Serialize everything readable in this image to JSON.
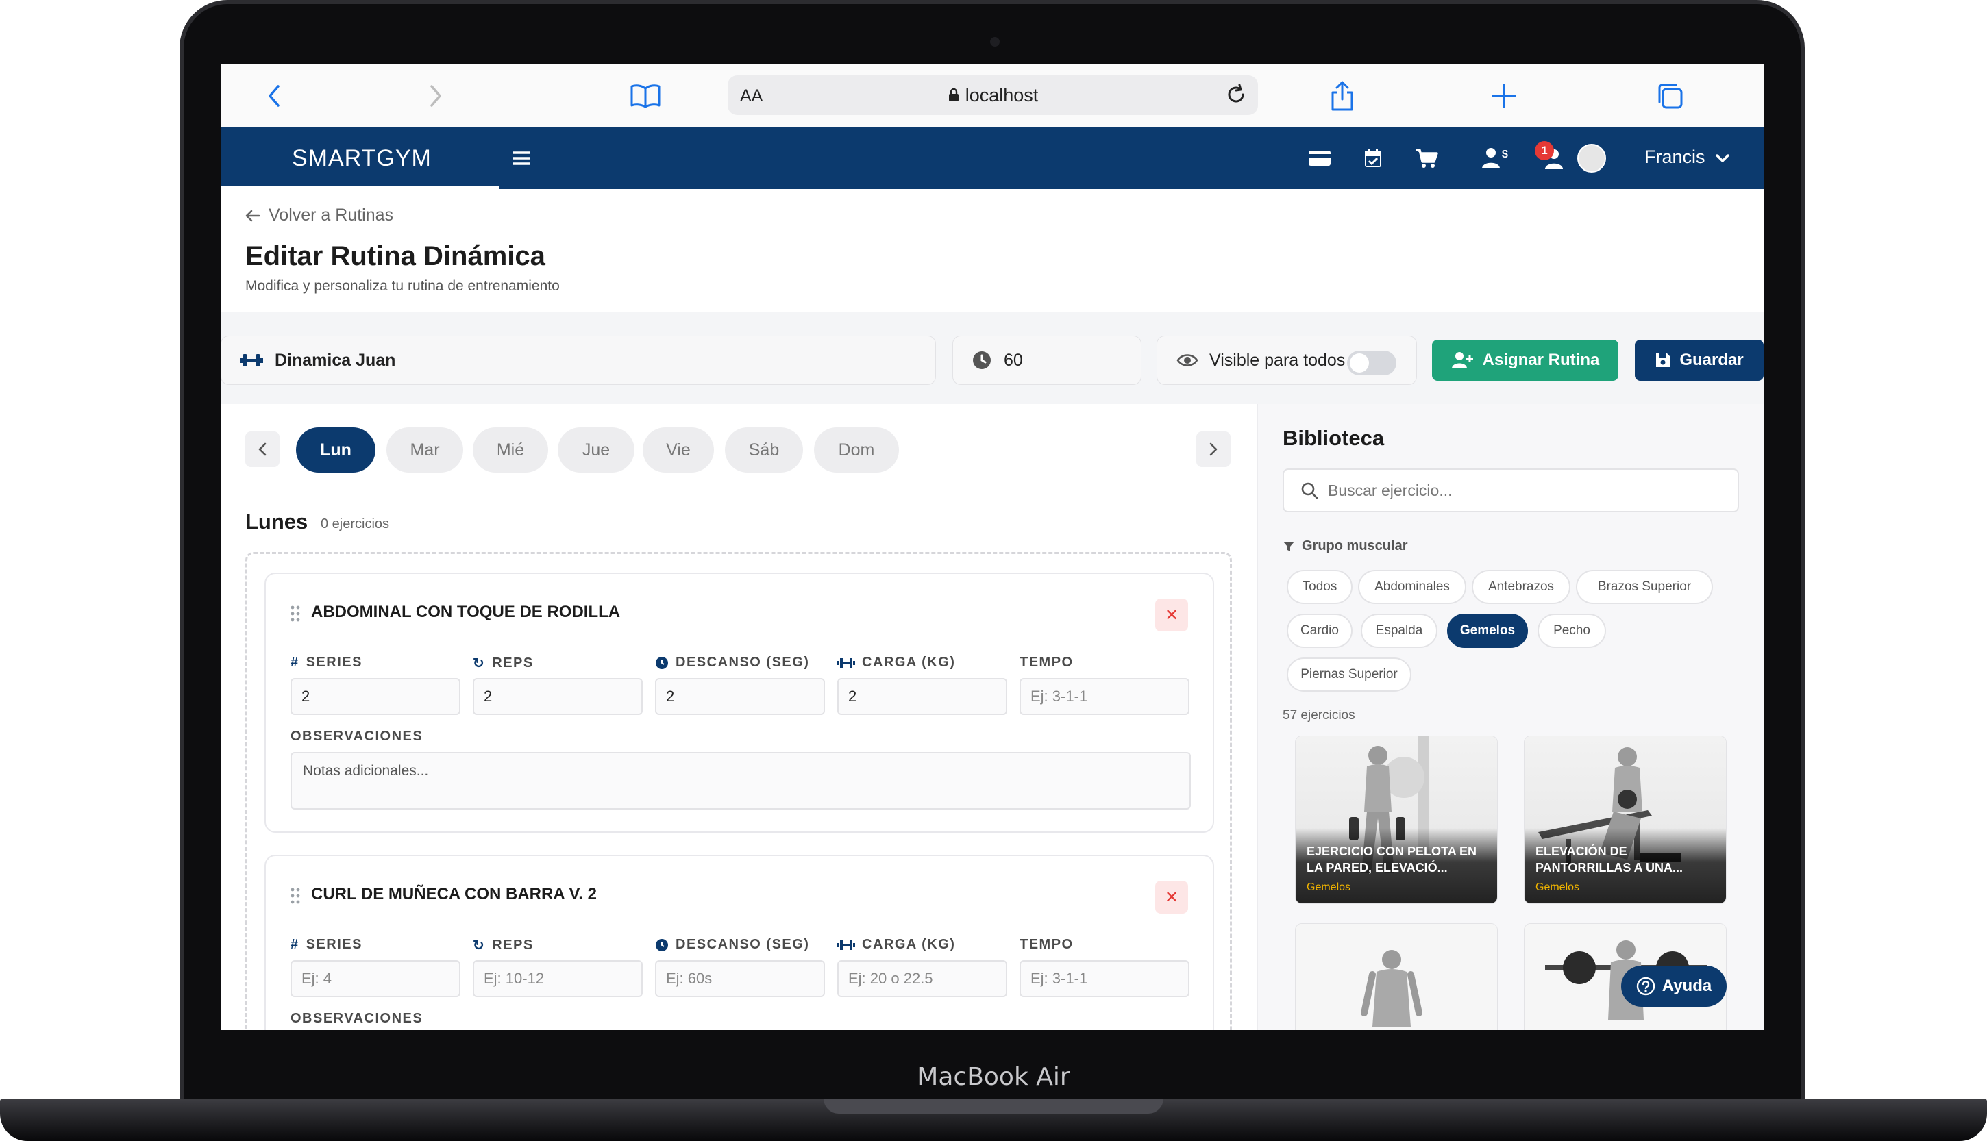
{
  "device": {
    "label": "MacBook Air"
  },
  "browser": {
    "aa": "AA",
    "url": "localhost"
  },
  "header": {
    "brand": "SMARTGYM",
    "notification_count": "1",
    "user_name": "Francis"
  },
  "page": {
    "back_label": "Volver a Rutinas",
    "title": "Editar Rutina Dinámica",
    "subtitle": "Modifica y personaliza tu rutina de entrenamiento"
  },
  "routine": {
    "name": "Dinamica Juan",
    "duration": "60",
    "visibility_label": "Visible para todos",
    "visibility_on": false,
    "assign_label": "Asignar Rutina",
    "save_label": "Guardar"
  },
  "days": {
    "items": [
      "Lun",
      "Mar",
      "Mié",
      "Jue",
      "Vie",
      "Sáb",
      "Dom"
    ],
    "active_index": 0,
    "selected_title": "Lunes",
    "selected_count": "0 ejercicios"
  },
  "field_labels": {
    "series": "SERIES",
    "reps": "REPS",
    "rest": "DESCANSO (SEG)",
    "load": "CARGA (KG)",
    "tempo": "TEMPO",
    "observations": "OBSERVACIONES"
  },
  "exercises": [
    {
      "name": "ABDOMINAL CON TOQUE DE RODILLA",
      "series": "2",
      "reps": "2",
      "rest": "2",
      "load": "2",
      "tempo_placeholder": "Ej: 3-1-1",
      "notes_placeholder": "Notas adicionales..."
    },
    {
      "name": "CURL DE MUÑECA CON BARRA V. 2",
      "series_placeholder": "Ej: 4",
      "reps_placeholder": "Ej: 10-12",
      "rest_placeholder": "Ej: 60s",
      "load_placeholder": "Ej: 20 o 22.5",
      "tempo_placeholder": "Ej: 3-1-1"
    }
  ],
  "library": {
    "title": "Biblioteca",
    "search_placeholder": "Buscar ejercicio...",
    "filter_label": "Grupo muscular",
    "chips": [
      "Todos",
      "Abdominales",
      "Antebrazos",
      "Brazos Superior",
      "Cardio",
      "Espalda",
      "Gemelos",
      "Pecho",
      "Piernas Superior"
    ],
    "active_chip": "Gemelos",
    "count": "57 ejercicios",
    "cards": [
      {
        "name": "EJERCICIO CON PELOTA EN LA PARED, ELEVACIÓ...",
        "group": "Gemelos"
      },
      {
        "name": "ELEVACIÓN DE PANTORRILLAS A UNA...",
        "group": "Gemelos"
      }
    ]
  },
  "help": {
    "label": "Ayuda"
  },
  "colors": {
    "primary": "#0c3a6e",
    "success": "#1fa37a",
    "danger": "#e53935",
    "accent_tag": "#f0b400"
  }
}
